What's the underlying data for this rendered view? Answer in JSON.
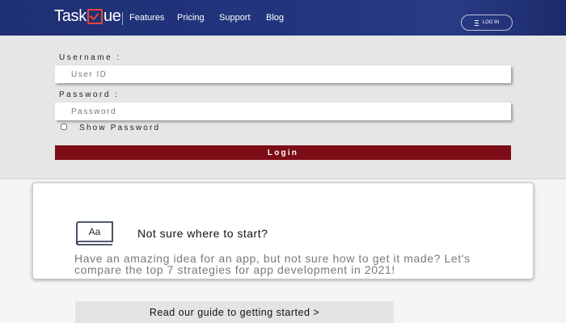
{
  "header": {
    "logo": {
      "before": "Task",
      "after": "ue"
    },
    "nav": [
      "Features",
      "Pricing",
      "Support",
      "Blog"
    ],
    "login_label": "LOG IN"
  },
  "form": {
    "username_label": "Username :",
    "username_placeholder": "User ID",
    "password_label": "Password :",
    "password_placeholder": "Password",
    "show_password_label": "Show Password",
    "show_password_checked": false,
    "login_button": "Login"
  },
  "guide": {
    "icon_text": "Aa",
    "title": "Not sure where to start?",
    "description": "Have an amazing idea for an app, but not sure how to get it made? Let's compare the top 7 strategies for app development in 2021!",
    "button": "Read our guide to getting started >"
  },
  "colors": {
    "header_bg": "#22357f",
    "login_button_bg": "#7d0c16",
    "logo_accent": "#e8463a"
  }
}
